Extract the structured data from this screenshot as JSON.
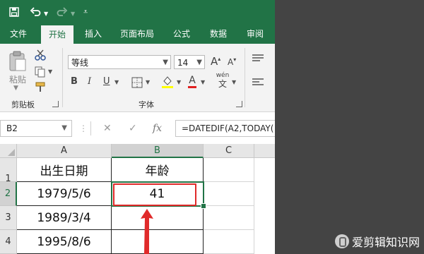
{
  "quick_access": {
    "save_icon": "save-icon",
    "undo_icon": "undo-icon",
    "redo_icon": "redo-icon",
    "customize_icon": "customize-icon"
  },
  "tabs": [
    {
      "label": "文件",
      "active": false
    },
    {
      "label": "开始",
      "active": true
    },
    {
      "label": "插入",
      "active": false
    },
    {
      "label": "页面布局",
      "active": false
    },
    {
      "label": "公式",
      "active": false
    },
    {
      "label": "数据",
      "active": false
    },
    {
      "label": "审阅",
      "active": false
    }
  ],
  "ribbon": {
    "clipboard": {
      "label": "剪贴板",
      "paste_label": "粘贴"
    },
    "font": {
      "label": "字体",
      "font_name": "等线",
      "font_size": "14",
      "bold": "B",
      "italic": "I",
      "underline": "U",
      "font_color_glyph": "A",
      "phonetic_glyph": "wén",
      "phonetic_sub": "文"
    }
  },
  "formula_bar": {
    "name_box": "B2",
    "fx": "fx",
    "formula": "=DATEDIF(A2,TODAY("
  },
  "grid": {
    "columns": [
      "A",
      "B",
      "C"
    ],
    "rows": [
      "1",
      "2",
      "3",
      "4"
    ],
    "cells": {
      "A1": "出生日期",
      "B1": "年龄",
      "A2": "1979/5/6",
      "B2": "41",
      "A3": "1989/3/4",
      "B3": "",
      "A4": "1995/8/6",
      "B4": ""
    },
    "selected_cell": "B2"
  },
  "colors": {
    "accent": "#217346",
    "highlight": "#e02a2a"
  },
  "watermark": {
    "text": "爱剪辑知识网"
  }
}
